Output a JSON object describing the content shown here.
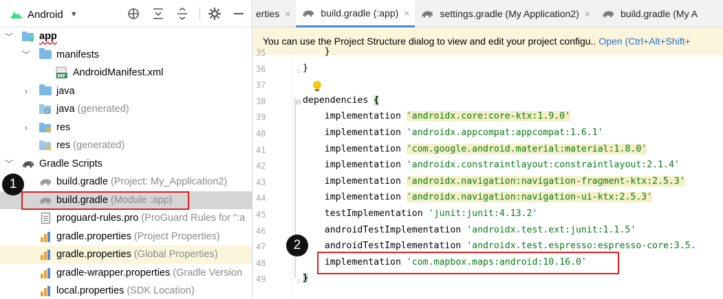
{
  "project_panel": {
    "view_mode": "Android",
    "toolbar_icons": [
      "add-icon",
      "expand-all-icon",
      "collapse-all-icon",
      "gear-icon",
      "minimize-icon"
    ],
    "tree": [
      {
        "label": "app",
        "suffix": "",
        "type": "module",
        "expanded": true
      },
      {
        "label": "manifests",
        "suffix": "",
        "type": "folder",
        "expanded": true
      },
      {
        "label": "AndroidManifest.xml",
        "suffix": "",
        "type": "manifest"
      },
      {
        "label": "java",
        "suffix": "",
        "type": "folder",
        "expanded": false
      },
      {
        "label": "java",
        "suffix": " (generated)",
        "type": "folder-gen"
      },
      {
        "label": "res",
        "suffix": "",
        "type": "res",
        "expanded": false
      },
      {
        "label": "res",
        "suffix": " (generated)",
        "type": "res-gen"
      },
      {
        "label": "Gradle Scripts",
        "suffix": "",
        "type": "gradle",
        "expanded": true
      },
      {
        "label": "build.gradle",
        "suffix": " (Project: My_Application2)",
        "type": "gradle-file"
      },
      {
        "label": "build.gradle",
        "suffix": " (Module :app)",
        "type": "gradle-file",
        "selected": true
      },
      {
        "label": "proguard-rules.pro",
        "suffix": " (ProGuard Rules for \":a",
        "type": "doc"
      },
      {
        "label": "gradle.properties",
        "suffix": " (Project Properties)",
        "type": "props"
      },
      {
        "label": "gradle.properties",
        "suffix": " (Global Properties)",
        "type": "props",
        "highlighted": true
      },
      {
        "label": "gradle-wrapper.properties",
        "suffix": " (Gradle Version",
        "type": "props"
      },
      {
        "label": "local.properties",
        "suffix": " (SDK Location)",
        "type": "props"
      }
    ]
  },
  "editor": {
    "tabs": [
      {
        "label": "erties",
        "active": false,
        "icon": false
      },
      {
        "label": "build.gradle (:app)",
        "active": true,
        "icon": true
      },
      {
        "label": "settings.gradle (My Application2)",
        "active": false,
        "icon": true
      },
      {
        "label": "build.gradle (My A",
        "active": false,
        "icon": true,
        "cut": true
      }
    ],
    "close_glyph": "×",
    "notice": {
      "text": "You can use the Project Structure dialog to view and edit your project configu..",
      "link": "Open (Ctrl+Alt+Shift+"
    },
    "lines": [
      {
        "num": "35",
        "parts": [
          {
            "t": "    }",
            "c": ""
          }
        ]
      },
      {
        "num": "36",
        "parts": [
          {
            "t": "}",
            "c": ""
          }
        ]
      },
      {
        "num": "37",
        "parts": [
          {
            "t": "",
            "c": ""
          }
        ]
      },
      {
        "num": "38",
        "parts": [
          {
            "t": "dependencies ",
            "c": ""
          },
          {
            "t": "{",
            "c": "brace"
          }
        ]
      },
      {
        "num": "39",
        "parts": [
          {
            "t": "    implementation ",
            "c": ""
          },
          {
            "t": "'androidx.core:core-ktx:1.9.0'",
            "c": "hl"
          }
        ]
      },
      {
        "num": "40",
        "parts": [
          {
            "t": "    implementation ",
            "c": ""
          },
          {
            "t": "'androidx.appcompat:appcompat:1.6.1'",
            "c": "str"
          }
        ]
      },
      {
        "num": "41",
        "parts": [
          {
            "t": "    implementation ",
            "c": ""
          },
          {
            "t": "'com.google.android.material:material:1.8.0'",
            "c": "hl"
          }
        ]
      },
      {
        "num": "42",
        "parts": [
          {
            "t": "    implementation ",
            "c": ""
          },
          {
            "t": "'androidx.constraintlayout:constraintlayout:2.1.4'",
            "c": "str"
          }
        ]
      },
      {
        "num": "43",
        "parts": [
          {
            "t": "    implementation ",
            "c": ""
          },
          {
            "t": "'androidx.navigation:navigation-fragment-ktx:2.5.3'",
            "c": "hl"
          }
        ]
      },
      {
        "num": "44",
        "parts": [
          {
            "t": "    implementation ",
            "c": ""
          },
          {
            "t": "'androidx.navigation:navigation-ui-ktx:2.5.3'",
            "c": "hl"
          }
        ]
      },
      {
        "num": "45",
        "parts": [
          {
            "t": "    testImplementation ",
            "c": ""
          },
          {
            "t": "'junit:junit:4.13.2'",
            "c": "str"
          }
        ]
      },
      {
        "num": "46",
        "parts": [
          {
            "t": "    androidTestImplementation ",
            "c": ""
          },
          {
            "t": "'androidx.test.ext:junit:1.1.5'",
            "c": "str"
          }
        ]
      },
      {
        "num": "47",
        "parts": [
          {
            "t": "    androidTestImplementation ",
            "c": ""
          },
          {
            "t": "'androidx.test.espresso:espresso-core:3.5.",
            "c": "str"
          }
        ]
      },
      {
        "num": "48",
        "parts": [
          {
            "t": "    implementation ",
            "c": ""
          },
          {
            "t": "'com.mapbox.maps:android:10.16.0'",
            "c": "str"
          }
        ]
      },
      {
        "num": "49",
        "parts": [
          {
            "t": "}",
            "c": "brace"
          }
        ]
      }
    ]
  },
  "annotations": {
    "callout_1": "1",
    "callout_2": "2"
  },
  "colors": {
    "selection": "#d5d5d5",
    "accent": "#4a88d4",
    "string": "#067d17",
    "notice_bg": "#fbf5dc",
    "callout_box": "#e21b1b",
    "android_green": "#3ddc84"
  }
}
